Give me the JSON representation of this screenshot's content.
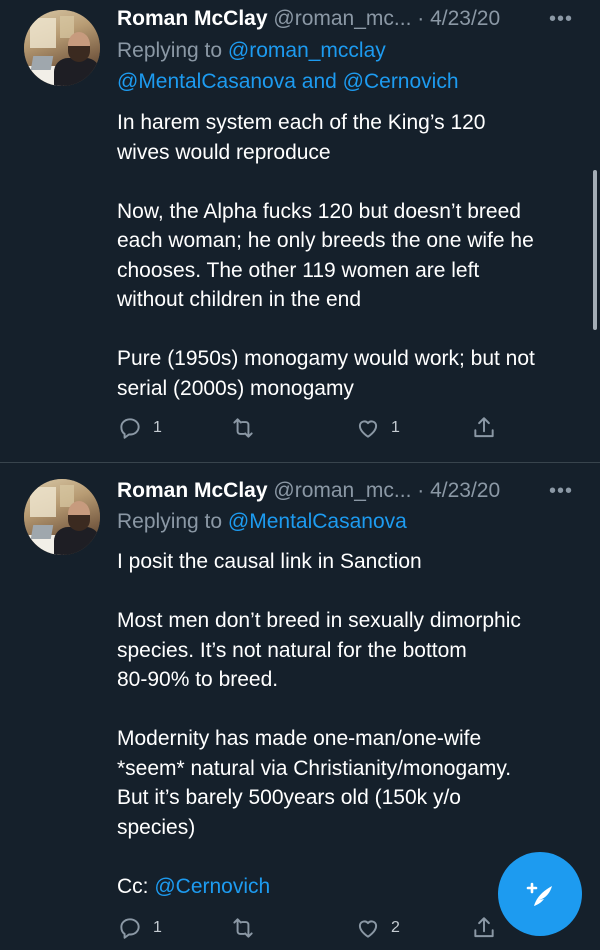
{
  "tweets": [
    {
      "name": "Roman McClay",
      "handle": "@roman_mc...",
      "date": "· 4/23/20",
      "replying_prefix": "Replying to",
      "replying_to_1": "@roman_mcclay",
      "replying_to_2": "@MentalCasanova",
      "replying_and": "and",
      "replying_to_3": "@Cernovich",
      "paragraphs": [
        [
          "In harem system each of the King’s 120",
          "wives would reproduce"
        ],
        [
          "Now, the Alpha fucks 120 but doesn’t breed",
          "each woman; he only breeds the one wife he",
          "chooses. The other 119 women are left",
          "without children in the end"
        ],
        [
          "Pure (1950s) monogamy would work; but not",
          "serial (2000s) monogamy"
        ]
      ],
      "reply_count": "1",
      "retweet_count": "",
      "like_count": "1"
    },
    {
      "name": "Roman McClay",
      "handle": "@roman_mc...",
      "date": "· 4/23/20",
      "replying_prefix": "Replying to",
      "replying_to_1": "@MentalCasanova",
      "paragraphs": [
        [
          "I posit the causal link in Sanction"
        ],
        [
          "Most men don’t breed in sexually dimorphic",
          "species. It’s not natural for the bottom",
          "80-90% to breed."
        ],
        [
          "Modernity has made one-man/one-wife",
          "*seem* natural via Christianity/monogamy.",
          "But it’s barely 500years old (150k y/o",
          "species)"
        ]
      ],
      "cc_prefix": "Cc:",
      "cc_mention": "@Cernovich",
      "reply_count": "1",
      "retweet_count": "",
      "like_count": "2"
    }
  ],
  "icons": {
    "more": "more-horizontal-icon",
    "reply": "reply-bubble-icon",
    "retweet": "retweet-icon",
    "like": "heart-icon",
    "share": "share-icon",
    "compose": "compose-feather-icon"
  },
  "colors": {
    "background": "#15202b",
    "accent": "#1d9bf0",
    "muted": "#8b98a5",
    "divider": "#38444d"
  }
}
